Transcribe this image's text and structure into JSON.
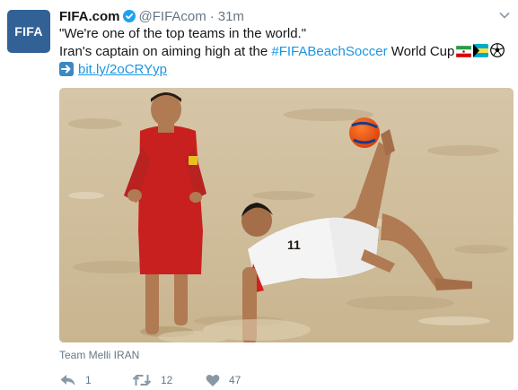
{
  "tweet": {
    "avatar_text": "FIFA",
    "account_name": "FIFA.com",
    "handle": "@FIFAcom",
    "separator": "·",
    "time": "31m",
    "quote_line": "\"We're one of the top teams in the world.\"",
    "text_prefix": "Iran's captain on aiming high at the ",
    "hashtag": "#FIFABeachSoccer",
    "text_suffix": " World Cup",
    "link": "bit.ly/2oCRYyp",
    "photo_caption": "Team Melli IRAN",
    "colors": {
      "link": "#1b95e0",
      "avatar_bg": "#326295",
      "muted": "#657786"
    }
  },
  "actions": {
    "reply_count": "1",
    "retweet_count": "12",
    "like_count": "47"
  },
  "icons": [
    "verified-badge-icon",
    "caret-down-icon",
    "iran-flag-icon",
    "bahamas-flag-icon",
    "soccer-ball-icon",
    "right-arrow-icon",
    "reply-icon",
    "retweet-icon",
    "heart-icon"
  ]
}
